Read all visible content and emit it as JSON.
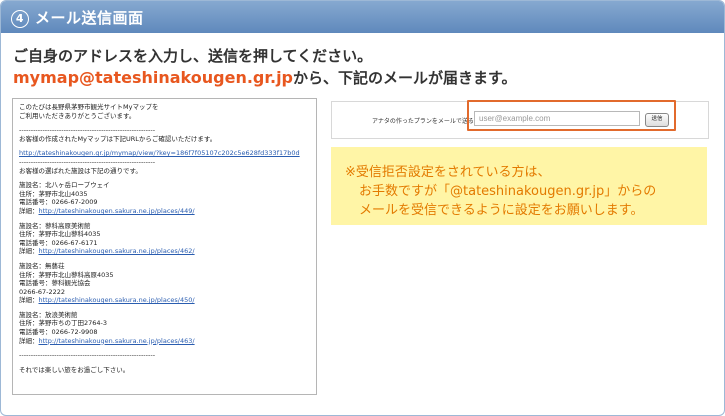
{
  "header": {
    "step": "4",
    "title": "メール送信画面"
  },
  "instructions": {
    "line1": "ご自身のアドレスを入力し、送信を押してください。",
    "domain": "mymap@tateshinakougen.gr.jp",
    "line2_rest": "から、下記のメールが届きます。"
  },
  "email": {
    "lines": [
      "このたびは長野県茅野市観光サイトMyマップを",
      "ご利用いただきありがとうございます。",
      "",
      "----------------------------------------------------------",
      "お客様の作成されたMyマップは下記URLからご確認いただけます。",
      "",
      "http://tateshinakougen.gr.jp/mymap/view/?key=186f7f05107c202c5e628fd333f17b0d",
      "----------------------------------------------------------",
      "お客様の選ばれた施設は下記の通りです。",
      "",
      "施設名：北八ヶ岳ロープウェイ",
      "住所：茅野市北山4035",
      "電話番号：0266-67-2009",
      "詳細：http://tateshinakougen.sakura.ne.jp/places/449/",
      "",
      "施設名：蓼科高原美術館",
      "住所：茅野市北山蓼科4035",
      "電話番号：0266-67-6171",
      "詳細：http://tateshinakougen.sakura.ne.jp/places/462/",
      "",
      "施設名：無藝荘",
      "住所：茅野市北山蓼科高原4035",
      "電話番号：蓼科観光協会",
      "0266-67-2222",
      "詳細：http://tateshinakougen.sakura.ne.jp/places/450/",
      "",
      "施設名：放浪美術館",
      "住所：茅野市ちの丁田2764-3",
      "電話番号：0266-72-9908",
      "詳細：http://tateshinakougen.sakura.ne.jp/places/463/",
      "",
      "----------------------------------------------------------",
      "",
      "それでは楽しい旅をお過ごし下さい。"
    ]
  },
  "form": {
    "label": "アナタの作ったプランをメールで送る",
    "placeholder": "user@example.com",
    "send_label": "送信"
  },
  "notice": {
    "line1": "※受信拒否設定をされている方は、",
    "line2": "お手数ですが「@tateshinakougen.gr.jp」からの",
    "line3": "メールを受信できるように設定をお願いします。"
  },
  "colors": {
    "header": "#6f95c4",
    "accent": "#e8571f",
    "notice_bg": "#fff5a6",
    "notice_text": "#e37a00",
    "highlight": "#e26a2c"
  }
}
